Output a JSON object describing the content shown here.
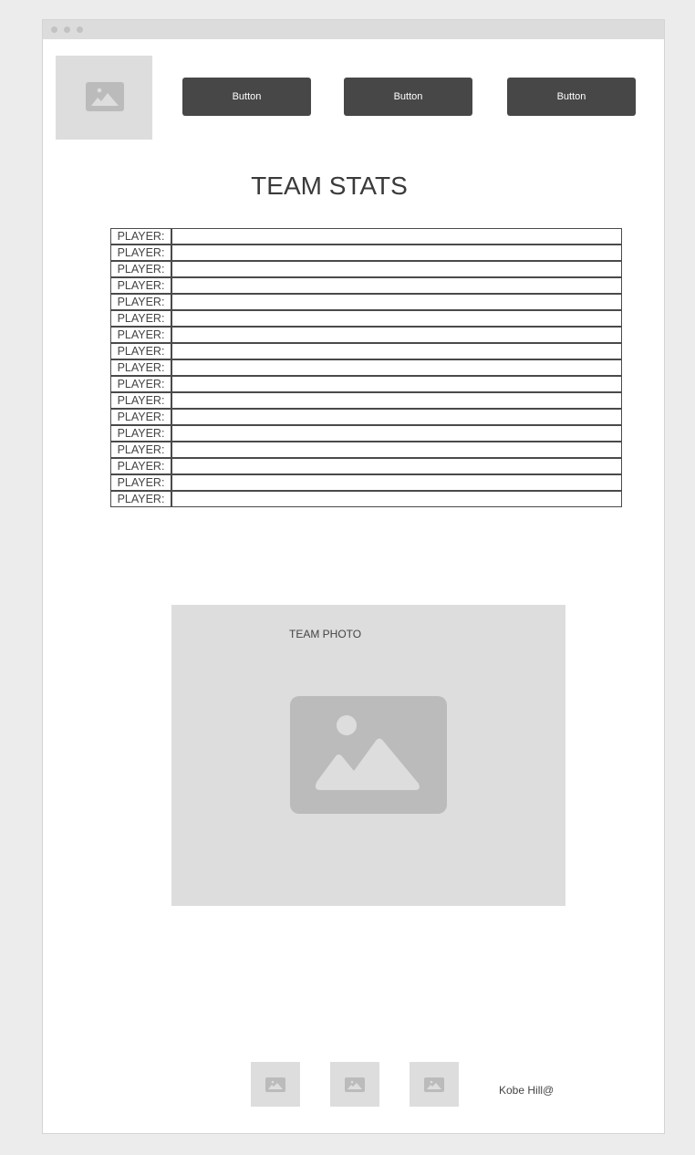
{
  "header": {
    "buttons": [
      {
        "label": "Button"
      },
      {
        "label": "Button"
      },
      {
        "label": "Button"
      }
    ]
  },
  "main": {
    "title": "TEAM STATS",
    "players": [
      {
        "label": "PLAYER:",
        "value": ""
      },
      {
        "label": "PLAYER:",
        "value": ""
      },
      {
        "label": "PLAYER:",
        "value": ""
      },
      {
        "label": "PLAYER:",
        "value": ""
      },
      {
        "label": "PLAYER:",
        "value": ""
      },
      {
        "label": "PLAYER:",
        "value": ""
      },
      {
        "label": "PLAYER:",
        "value": ""
      },
      {
        "label": "PLAYER:",
        "value": ""
      },
      {
        "label": "PLAYER:",
        "value": ""
      },
      {
        "label": "PLAYER:",
        "value": ""
      },
      {
        "label": "PLAYER:",
        "value": ""
      },
      {
        "label": "PLAYER:",
        "value": ""
      },
      {
        "label": "PLAYER:",
        "value": ""
      },
      {
        "label": "PLAYER:",
        "value": ""
      },
      {
        "label": "PLAYER:",
        "value": ""
      },
      {
        "label": "PLAYER:",
        "value": ""
      },
      {
        "label": "PLAYER:",
        "value": ""
      }
    ],
    "team_photo_label": "TEAM PHOTO"
  },
  "footer": {
    "credit": "Kobe Hill@"
  },
  "icons": {
    "image_placeholder": "image-icon"
  },
  "colors": {
    "button_bg": "#474747",
    "placeholder_bg": "#dddddd",
    "placeholder_icon": "#bbbbbb"
  }
}
